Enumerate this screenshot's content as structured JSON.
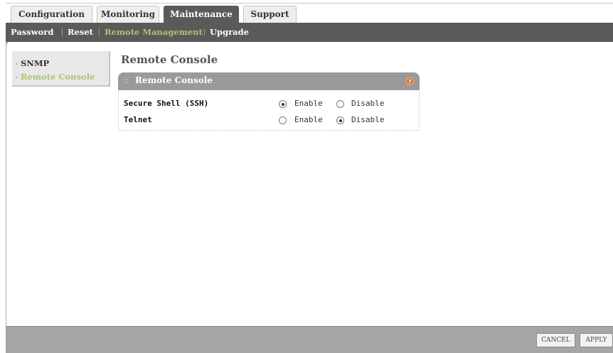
{
  "tabs": [
    {
      "label": "Configuration"
    },
    {
      "label": "Monitoring"
    },
    {
      "label": "Maintenance"
    },
    {
      "label": "Support"
    }
  ],
  "subnav": [
    {
      "label": "Password"
    },
    {
      "label": "Reset"
    },
    {
      "label": "Remote Management"
    },
    {
      "label": "Upgrade"
    }
  ],
  "sidebar": {
    "items": [
      {
        "label": "SNMP"
      },
      {
        "label": "Remote Console"
      }
    ]
  },
  "page_title": "Remote Console",
  "panel": {
    "title": "Remote Console",
    "help_icon": "?",
    "rows": [
      {
        "label": "Secure Shell (SSH)",
        "enable_label": "Enable",
        "disable_label": "Disable",
        "selected": "Enable"
      },
      {
        "label": "Telnet",
        "enable_label": "Enable",
        "disable_label": "Disable",
        "selected": "Disable"
      }
    ]
  },
  "footer": {
    "cancel_label": "CANCEL",
    "apply_label": "APPLY"
  },
  "icons": {
    "panel_grip": "grip-icon",
    "help": "help-icon",
    "menu_arrow": "chevron-right-icon"
  },
  "colors": {
    "nav_bg": "#5a5a5a",
    "active_link": "#a8c478",
    "panel_head": "#9a9a9a",
    "help_icon": "#e06a1c",
    "footer_bg": "#a5a5a5"
  }
}
